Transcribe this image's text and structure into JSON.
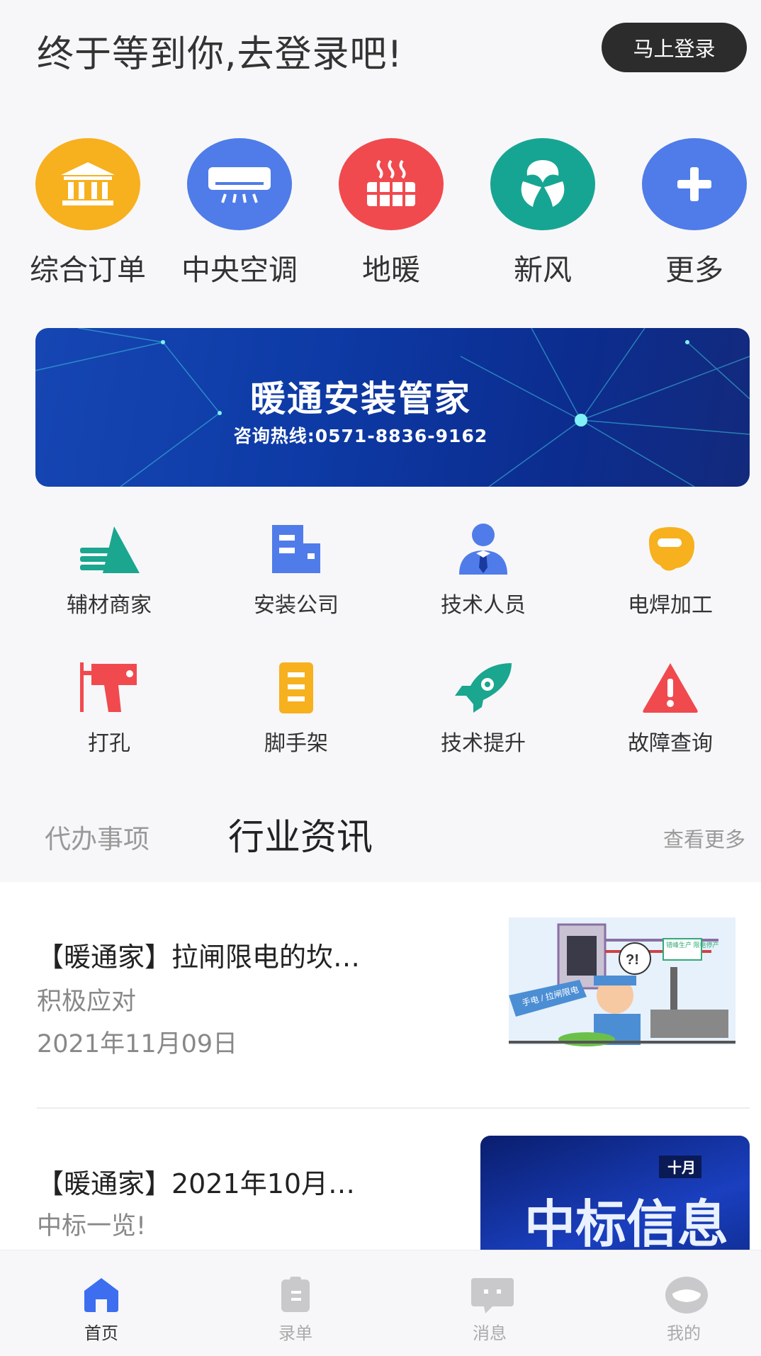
{
  "header": {
    "greeting": "终于等到你,去登录吧!",
    "login_button": "马上登录"
  },
  "categories": [
    {
      "label": "综合订单",
      "icon": "bank-icon",
      "color": "#f7b01e"
    },
    {
      "label": "中央空调",
      "icon": "air-conditioner-icon",
      "color": "#4f7ce9"
    },
    {
      "label": "地暖",
      "icon": "floor-heating-icon",
      "color": "#f04a4f"
    },
    {
      "label": "新风",
      "icon": "fresh-air-icon",
      "color": "#17a593"
    },
    {
      "label": "更多",
      "icon": "plus-icon",
      "color": "#4f7ce9"
    }
  ],
  "banner": {
    "title": "暖通安装管家",
    "hotline": "咨询热线:0571-8836-9162"
  },
  "services": [
    {
      "label": "辅材商家",
      "icon": "materials-icon",
      "color": "#1aa68f"
    },
    {
      "label": "安装公司",
      "icon": "building-icon",
      "color": "#4f7ce9"
    },
    {
      "label": "技术人员",
      "icon": "technician-icon",
      "color": "#4f7ce9"
    },
    {
      "label": "电焊加工",
      "icon": "welding-mask-icon",
      "color": "#f7b01e"
    },
    {
      "label": "打孔",
      "icon": "drill-icon",
      "color": "#f04a4f"
    },
    {
      "label": "脚手架",
      "icon": "ladder-icon",
      "color": "#f7b01e"
    },
    {
      "label": "技术提升",
      "icon": "rocket-icon",
      "color": "#1aa68f"
    },
    {
      "label": "故障查询",
      "icon": "warning-icon",
      "color": "#f04a4f"
    }
  ],
  "tabs": {
    "todo": "代办事项",
    "news": "行业资讯",
    "see_more": "查看更多"
  },
  "news": [
    {
      "title": "【暖通家】拉闸限电的坎…",
      "subtitle": "积极应对",
      "date": "2021年11月09日"
    },
    {
      "title": "【暖通家】2021年10月…",
      "subtitle": "中标一览!",
      "thumb_badge": "十月",
      "thumb_text": "中标信息"
    }
  ],
  "thumb1_text": {
    "sign": "手电 / 拉闸限电",
    "bubble": "?!",
    "board": "错峰生产 限电停产"
  },
  "bottom_nav": [
    {
      "label": "首页",
      "icon": "home-icon",
      "active": true
    },
    {
      "label": "录单",
      "icon": "clipboard-icon",
      "active": false
    },
    {
      "label": "消息",
      "icon": "message-icon",
      "active": false
    },
    {
      "label": "我的",
      "icon": "profile-icon",
      "active": false
    }
  ],
  "colors": {
    "accent": "#3d6ef0",
    "dark_button": "#2c2c2c"
  }
}
